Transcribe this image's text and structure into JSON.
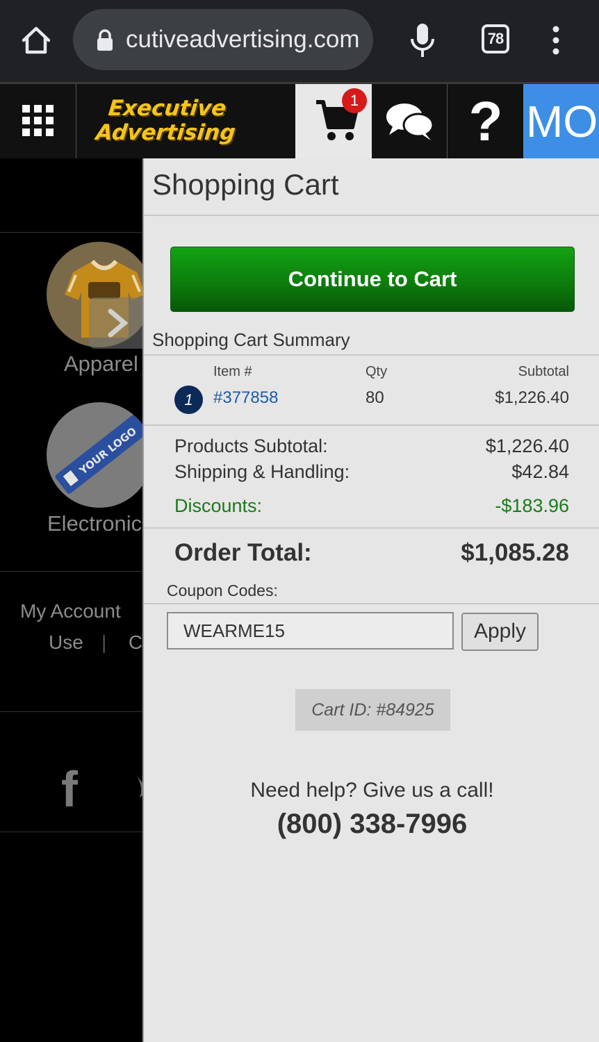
{
  "browser": {
    "url": "cutiveadvertising.com",
    "tab_count": "78",
    "icons": [
      "home-icon",
      "lock-icon",
      "mic-icon",
      "kebab-menu-icon"
    ]
  },
  "header": {
    "logo_line1": "Executive",
    "logo_line2": "Advertising",
    "cart_badge": "1",
    "help_label": "?",
    "more_label": "MO",
    "accent_blue": "#3d8fe6",
    "logo_yellow": "#f5c518"
  },
  "background": {
    "categories": [
      {
        "label": "Apparel"
      },
      {
        "label": "Electronic"
      }
    ],
    "my_account": "My Account",
    "links": [
      "Use",
      "|",
      "C"
    ],
    "social_icons": [
      "facebook-icon",
      "twitter-icon"
    ]
  },
  "cart": {
    "title": "Shopping Cart",
    "continue_label": "Continue to Cart",
    "summary_title": "Shopping Cart Summary",
    "columns": {
      "item": "Item #",
      "qty": "Qty",
      "subtotal": "Subtotal"
    },
    "items": [
      {
        "num": "1",
        "item": "#377858",
        "qty": "80",
        "subtotal": "$1,226.40"
      }
    ],
    "products_subtotal_label": "Products Subtotal:",
    "products_subtotal": "$1,226.40",
    "shipping_label": "Shipping & Handling:",
    "shipping": "$42.84",
    "discounts_label": "Discounts:",
    "discounts": "-$183.96",
    "order_total_label": "Order Total:",
    "order_total": "$1,085.28",
    "coupon_label": "Coupon Codes:",
    "coupon_value": "WEARME15",
    "apply_label": "Apply",
    "cart_id": "Cart ID: #84925",
    "help_text": "Need help? Give us a call!",
    "phone": "(800) 338-7996",
    "continue_color": "#0c7a0c",
    "discount_color": "#1a7a1a"
  }
}
